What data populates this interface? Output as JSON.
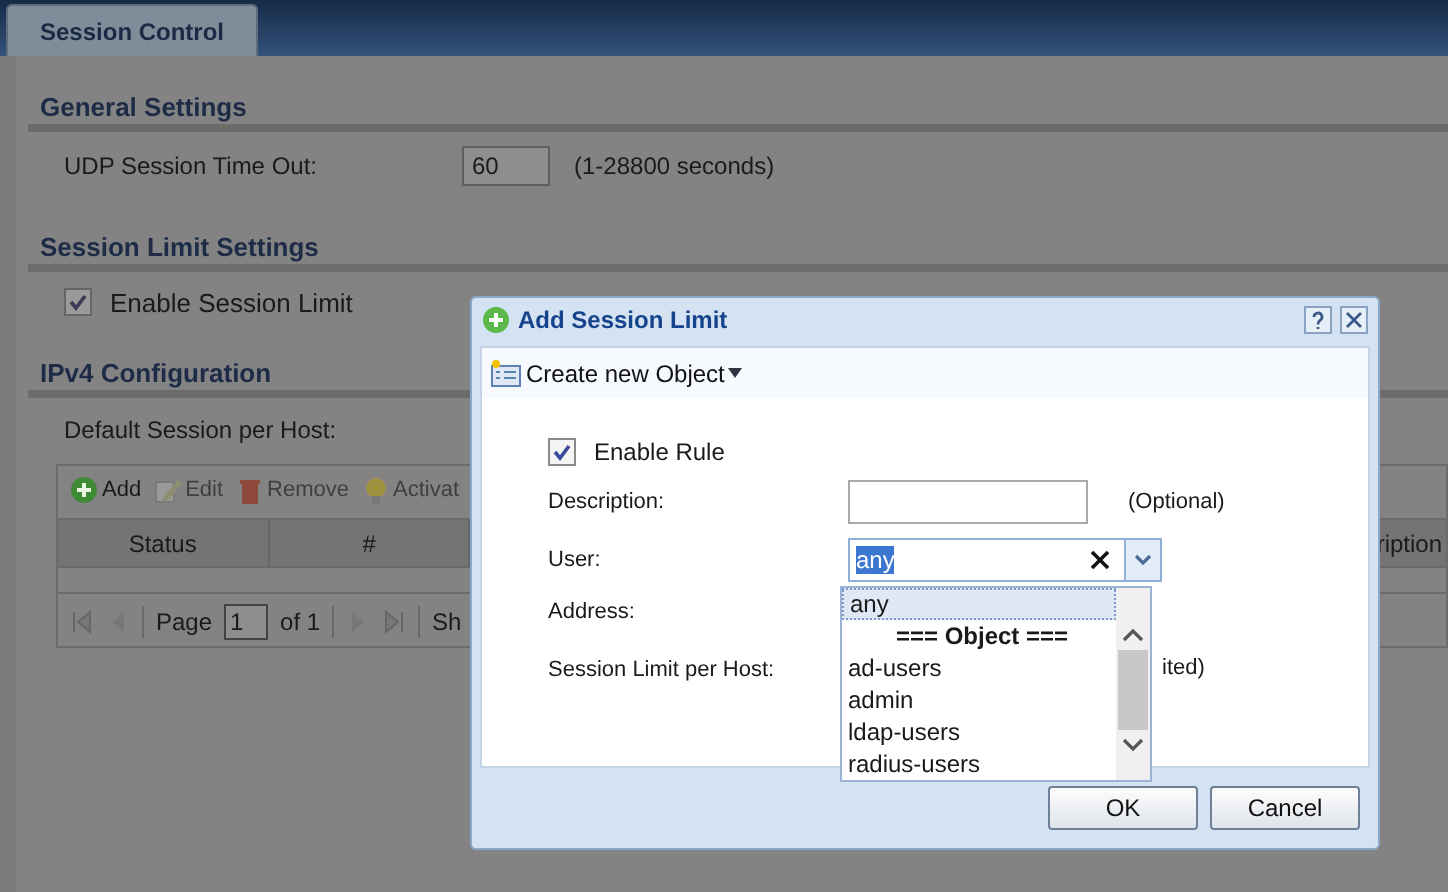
{
  "tabs": [
    {
      "label": "Session Control",
      "selected": true
    }
  ],
  "general_settings": {
    "title": "General Settings",
    "udp_timeout": {
      "label": "UDP Session Time Out:",
      "value": "60",
      "hint": "(1-28800 seconds)"
    }
  },
  "session_limit_settings": {
    "title": "Session Limit Settings",
    "enable": {
      "label": "Enable Session Limit",
      "checked": true
    }
  },
  "ipv4_configuration": {
    "title": "IPv4 Configuration",
    "default_session_label": "Default Session per Host:",
    "toolbar": [
      {
        "label": "Add",
        "kind": "add",
        "disabled": false
      },
      {
        "label": "Edit",
        "kind": "edit",
        "disabled": true
      },
      {
        "label": "Remove",
        "kind": "remove",
        "disabled": true
      },
      {
        "label": "Activat",
        "kind": "activate",
        "disabled": true
      }
    ],
    "table": {
      "columns": [
        "Status",
        "#",
        "ription"
      ]
    },
    "pager": {
      "page_label": "Page",
      "page": "1",
      "of_label": "of 1",
      "show_label": "Sh"
    }
  },
  "dialog": {
    "title": "Add Session Limit",
    "toolbar_label": "Create new Object",
    "enable_rule": {
      "label": "Enable Rule",
      "checked": true
    },
    "description": {
      "label": "Description:",
      "hint": "(Optional)"
    },
    "user": {
      "label": "User:",
      "value": "any"
    },
    "address": {
      "label": "Address:"
    },
    "session_limit": {
      "label": "Session Limit per Host:",
      "hint": "ited)"
    },
    "dropdown": [
      {
        "label": "any",
        "kind": "option",
        "selected": true
      },
      {
        "label": "=== Object ===",
        "kind": "header",
        "selected": false
      },
      {
        "label": "ad-users",
        "kind": "option",
        "selected": false
      },
      {
        "label": "admin",
        "kind": "option",
        "selected": false
      },
      {
        "label": "ldap-users",
        "kind": "option",
        "selected": false
      },
      {
        "label": "radius-users",
        "kind": "option",
        "selected": false
      }
    ],
    "buttons": [
      "OK",
      "Cancel"
    ]
  }
}
